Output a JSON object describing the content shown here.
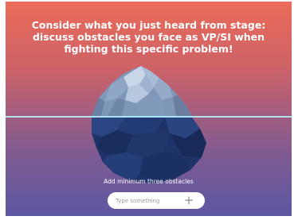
{
  "prompt": {
    "text": "Consider what you just heard from stage:\ndiscuss obstacles you face as VP/SI when\nfighting this specific problem!"
  },
  "hint": "Add minimum three obstacles",
  "input": {
    "placeholder": "Type something",
    "value": ""
  },
  "add_button": {
    "icon": "plus-icon",
    "symbol": "+"
  },
  "illustration": {
    "icon": "iceberg-icon"
  },
  "colors": {
    "gradient_top": "#ea6b58",
    "gradient_bottom": "#5e58a2",
    "waterline": "#aee3ef",
    "text": "#ffffff"
  }
}
